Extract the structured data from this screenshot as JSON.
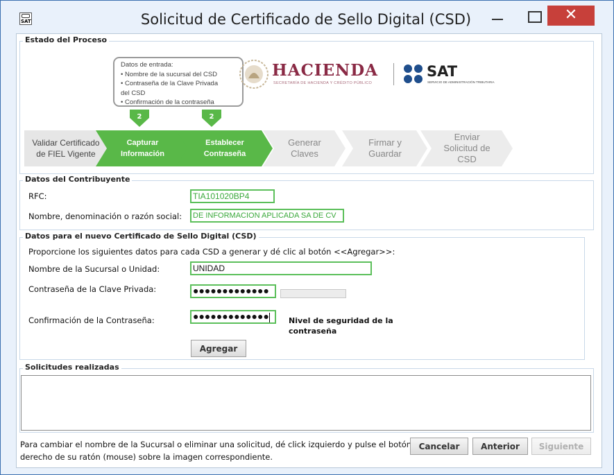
{
  "window": {
    "title": "Solicitud de Certificado de Sello Digital (CSD)",
    "icon_text": "SAT",
    "close_glyph": "✕"
  },
  "estado_proceso": {
    "title": "Estado del Proceso",
    "callout_lines": [
      "Datos de entrada:",
      "• Nombre de la sucursal del CSD",
      "• Contraseña de la Clave Privada",
      "del CSD",
      "• Confirmación de la contraseña"
    ],
    "badge_number": "2",
    "steps": [
      {
        "label_line1": "Validar Certificado",
        "label_line2": "de FIEL Vigente",
        "state": "done"
      },
      {
        "label_line1": "Capturar",
        "label_line2": "Información",
        "state": "active"
      },
      {
        "label_line1": "Establecer",
        "label_line2": "Contraseña",
        "state": "active"
      },
      {
        "label_line1": "Generar",
        "label_line2": "Claves",
        "state": "pending"
      },
      {
        "label_line1": "Firmar y",
        "label_line2": "Guardar",
        "state": "pending"
      },
      {
        "label_line1": "Enviar",
        "label_line2": "Solicitud de",
        "label_line3": "CSD",
        "state": "pending"
      }
    ],
    "logos": {
      "hacienda_name": "HACIENDA",
      "hacienda_sub": "SECRETARÍA DE HACIENDA Y CRÉDITO PÚBLICO",
      "sat_name": "SAT",
      "sat_sub": "SERVICIO DE ADMINISTRACIÓN TRIBUTARIA"
    }
  },
  "contribuyente": {
    "title": "Datos del Contribuyente",
    "rfc_label": "RFC:",
    "rfc_value": "TIA101020BP4",
    "nombre_label": "Nombre, denominación o razón social:",
    "nombre_value": "DE INFORMACION APLICADA SA DE CV"
  },
  "nuevo_csd": {
    "title": "Datos para el nuevo Certificado de Sello Digital (CSD)",
    "instruction": "Proporcione los siguientes datos para cada CSD a generar y dé clic al botón <<Agregar>>:",
    "sucursal_label": "Nombre de la Sucursal o Unidad:",
    "sucursal_value": "UNIDAD",
    "clave_label": "Contraseña de la Clave Privada:",
    "clave_value": "●●●●●●●●●●●●●",
    "confirm_label": "Confirmación de la Contraseña:",
    "confirm_value": "●●●●●●●●●●●●●",
    "nivel_label_line1": "Nivel de seguridad de la",
    "nivel_label_line2": "contraseña",
    "agregar_label": "Agregar"
  },
  "solicitudes": {
    "title": "Solicitudes realizadas"
  },
  "footer": {
    "hint_line1": "Para cambiar el nombre de la Sucursal o eliminar una solicitud, dé click izquierdo y pulse el botón",
    "hint_line2": "derecho de su ratón (mouse) sobre la imagen correspondiente.",
    "cancelar_label": "Cancelar",
    "anterior_label": "Anterior",
    "siguiente_label": "Siguiente"
  },
  "colors": {
    "step_done": "#e6e6e6",
    "step_active": "#59b848",
    "step_pending": "#ececec",
    "field_border": "#5bbf5a",
    "hacienda": "#8a2a45",
    "sat": "#1f4e8c"
  }
}
